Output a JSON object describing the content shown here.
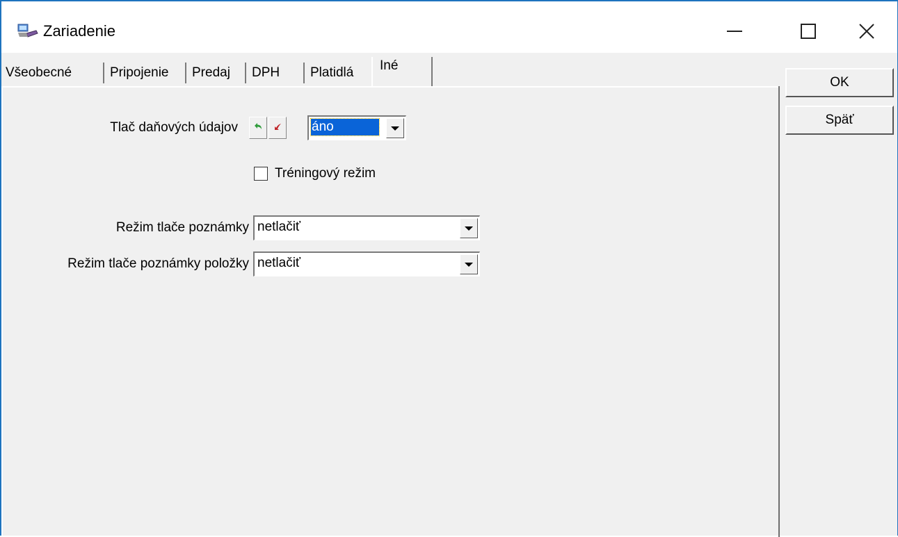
{
  "window": {
    "title": "Zariadenie",
    "icon": "device-app-icon",
    "controls": [
      "minimize-icon",
      "maximize-icon",
      "close-icon"
    ]
  },
  "tabs": [
    {
      "label": "Všeobecné",
      "active": false
    },
    {
      "label": "Pripojenie",
      "active": false
    },
    {
      "label": "Predaj",
      "active": false
    },
    {
      "label": "DPH",
      "active": false
    },
    {
      "label": "Platidlá",
      "active": false
    },
    {
      "label": "Iné",
      "active": true
    }
  ],
  "form": {
    "tax_print_label": "Tlač daňových údajov",
    "tax_print_value": "áno",
    "undo_icon": "undo-green-arrow-icon",
    "redo_icon": "redo-red-arrow-icon",
    "training_mode_label": "Tréningový režim",
    "training_mode_checked": false,
    "note_print_label": "Režim tlače poznámky",
    "note_print_value": "netlačiť",
    "item_note_print_label": "Režim tlače poznámky položky",
    "item_note_print_value": "netlačiť"
  },
  "buttons": {
    "ok_label": "OK",
    "back_label": "Späť"
  },
  "colors": {
    "window_border": "#1e73be",
    "selection": "#0a64d8",
    "dialog_bg": "#f0f0f0"
  }
}
